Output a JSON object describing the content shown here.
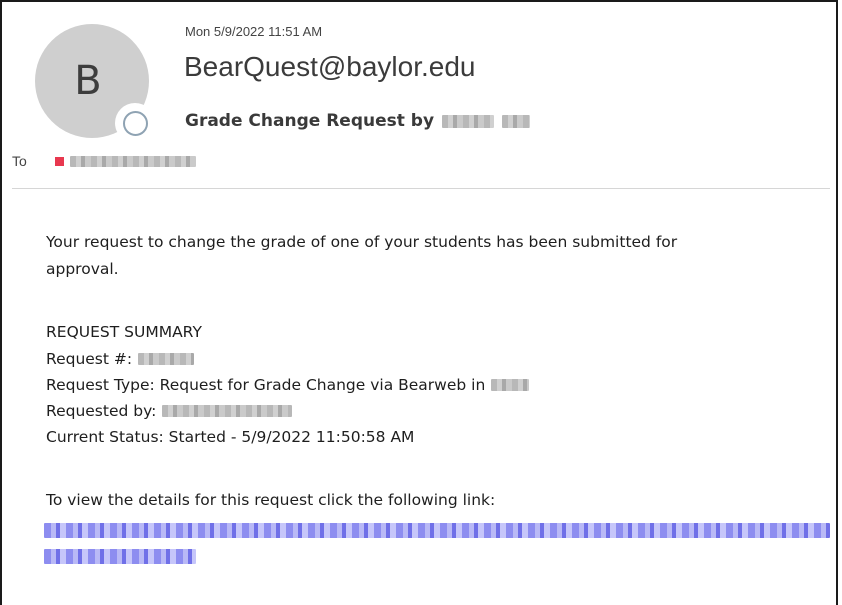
{
  "email": {
    "avatar_letter": "B",
    "timestamp": "Mon 5/9/2022 11:51 AM",
    "sender": "BearQuest@baylor.edu",
    "subject_prefix": "Grade Change Request by",
    "to_label": "To"
  },
  "body": {
    "intro_line1": "Your request to change the grade of one of your students has been submitted for",
    "intro_line2": "approval.",
    "summary_heading": "REQUEST SUMMARY",
    "request_number_label": "Request #:",
    "request_type_label": "Request Type: Request for Grade Change via Bearweb in",
    "requested_by_label": "Requested by:",
    "current_status": "Current Status: Started - 5/9/2022 11:50:58 AM",
    "view_details": "To view the details for this request click the following link:"
  },
  "colors": {
    "recipient_tag": "#e8384f",
    "link": "#7070e8",
    "avatar_bg": "#cfcfcf"
  }
}
